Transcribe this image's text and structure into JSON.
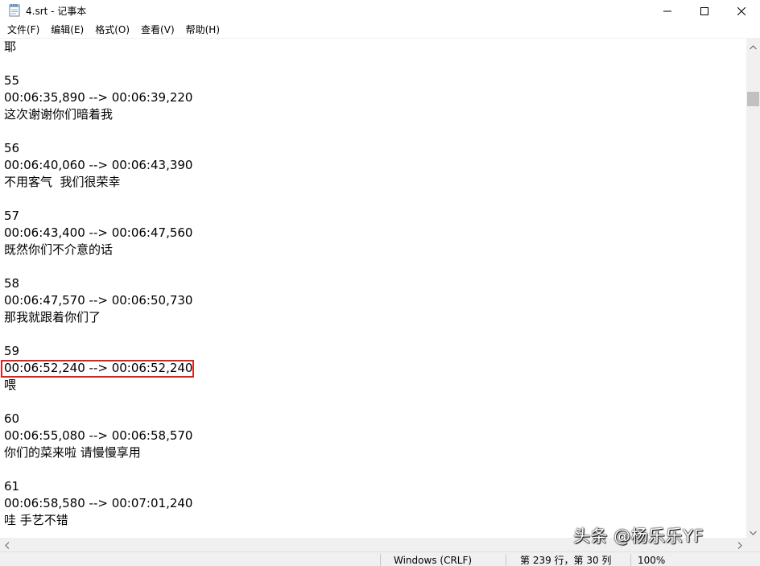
{
  "window": {
    "title": "4.srt - 记事本"
  },
  "icons": {
    "app": "notepad-icon",
    "minimize": "minimize-icon",
    "maximize": "maximize-icon",
    "close": "close-icon",
    "scroll_up": "chevron-up-icon",
    "scroll_down": "chevron-down-icon",
    "scroll_left": "chevron-left-icon",
    "scroll_right": "chevron-right-icon"
  },
  "menu": {
    "items": [
      {
        "label": "文件(F)"
      },
      {
        "label": "编辑(E)"
      },
      {
        "label": "格式(O)"
      },
      {
        "label": "查看(V)"
      },
      {
        "label": "帮助(H)"
      }
    ]
  },
  "editor": {
    "lines": [
      "耶",
      "",
      "55",
      "00:06:35,890 --> 00:06:39,220",
      "这次谢谢你们暗着我",
      "",
      "56",
      "00:06:40,060 --> 00:06:43,390",
      "不用客气  我们很荣幸",
      "",
      "57",
      "00:06:43,400 --> 00:06:47,560",
      "既然你们不介意的话",
      "",
      "58",
      "00:06:47,570 --> 00:06:50,730",
      "那我就跟着你们了",
      "",
      "59",
      "00:06:52,240 --> 00:06:52,240",
      "喂",
      "",
      "60",
      "00:06:55,080 --> 00:06:58,570",
      "你们的菜来啦 请慢慢享用",
      "",
      "61",
      "00:06:58,580 --> 00:07:01,240",
      "哇 手艺不错"
    ],
    "highlight_color": "#e02020"
  },
  "statusbar": {
    "encoding": "Windows (CRLF)",
    "position": "第 239 行，第 30 列",
    "zoom": "100%"
  },
  "watermark": {
    "text": "头条 @杨乐乐YF"
  }
}
